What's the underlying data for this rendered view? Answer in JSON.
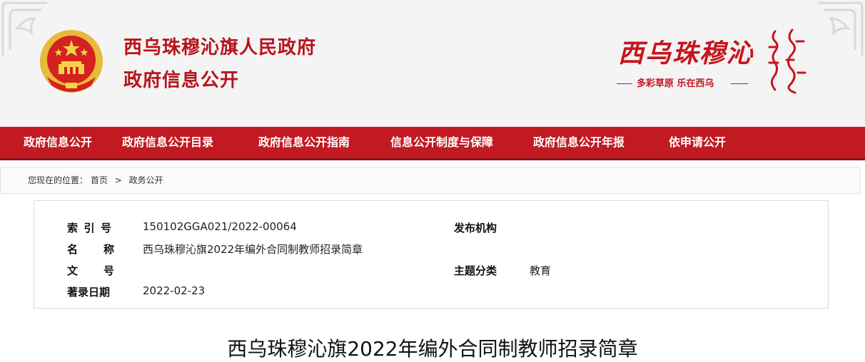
{
  "colors": {
    "brand_red": "#c11a22",
    "nav_text": "#ffffff",
    "header_bg": "#f4f4f4"
  },
  "header": {
    "site_title": "西乌珠穆沁旗人民政府",
    "site_subtitle": "政府信息公开",
    "brand_name": "西乌珠穆沁",
    "slogan": "多彩草原  乐在西乌",
    "emblem_icon": "national-emblem-icon"
  },
  "nav": {
    "items": [
      {
        "label": "政府信息公开"
      },
      {
        "label": "政府信息公开目录"
      },
      {
        "label": "政府信息公开指南"
      },
      {
        "label": "信息公开制度与保障"
      },
      {
        "label": "政府信息公开年报"
      },
      {
        "label": "依申请公开"
      }
    ]
  },
  "breadcrumb": {
    "prefix": "您现在的位置：",
    "home": "首页",
    "separator": ">",
    "current": "政务公开"
  },
  "info": {
    "index_label": [
      "索",
      "引",
      "号"
    ],
    "index_value": "150102GGA021/2022-00064",
    "name_label": [
      "名",
      "称"
    ],
    "name_value": "西乌珠穆沁旗2022年编外合同制教师招录简章",
    "doc_label": [
      "文",
      "号"
    ],
    "doc_value": "",
    "date_label": "著录日期",
    "date_value": "2022-02-23",
    "org_label": "发布机构",
    "org_value": "",
    "topic_label": "主题分类",
    "topic_value": "教育"
  },
  "article": {
    "title": "西乌珠穆沁旗2022年编外合同制教师招录简章"
  }
}
